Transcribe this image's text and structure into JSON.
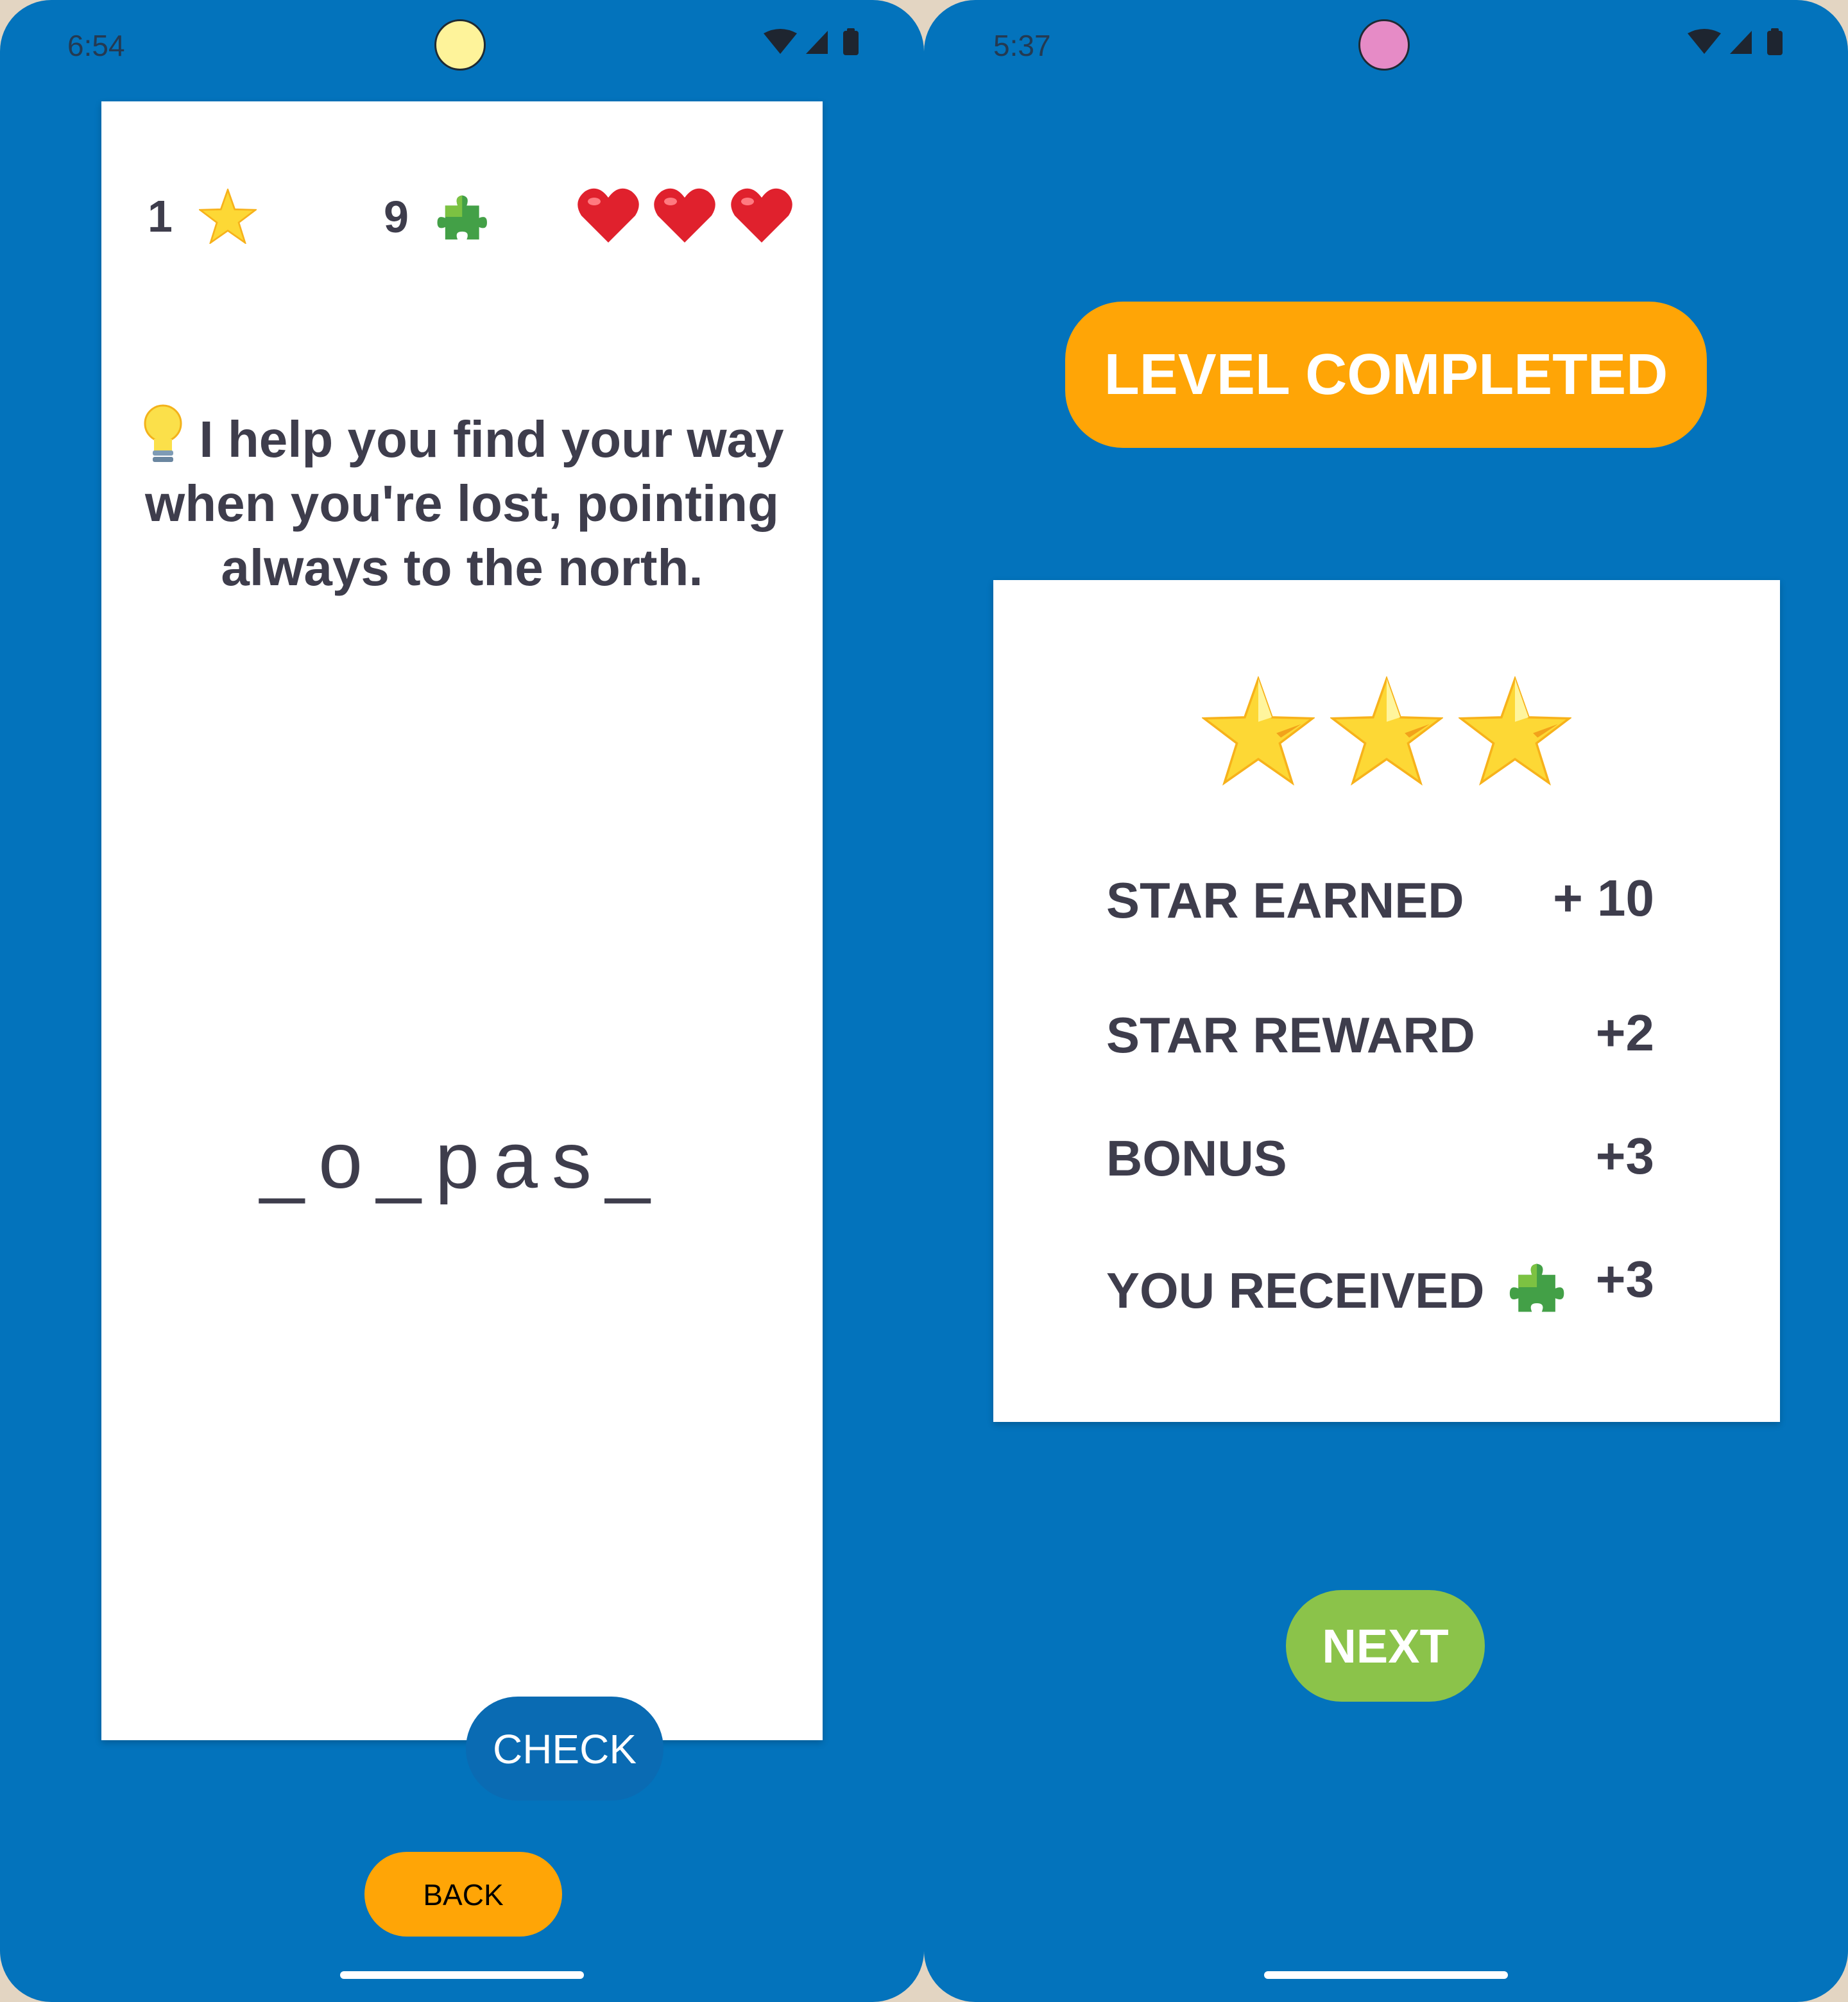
{
  "left_screen": {
    "status": {
      "time": "6:54",
      "camera_color": "#fef39a"
    },
    "stats": {
      "stars": "1",
      "stars_icon": "star-icon",
      "pieces": "9",
      "pieces_icon": "puzzle-piece-icon",
      "lives": 3,
      "lives_icon": "heart-icon"
    },
    "hint": {
      "icon": "light-bulb-icon",
      "text": "I help you find your way when you're lost, pointing always to the north."
    },
    "puzzle_word": "_o_pas_",
    "check_label": "CHECK",
    "back_label": "BACK"
  },
  "right_screen": {
    "status": {
      "time": "5:37",
      "camera_color": "#e68bc6"
    },
    "level_badge": "LEVEL COMPLETED",
    "stars_earned": 3,
    "rows": [
      {
        "label": "STAR EARNED",
        "value": "+ 10"
      },
      {
        "label": "STAR REWARD",
        "value": "+2"
      },
      {
        "label": "BONUS",
        "value": "+3"
      },
      {
        "label": "YOU RECEIVED",
        "value": "+3",
        "icon": "puzzle-piece-icon"
      }
    ],
    "next_label": "NEXT"
  },
  "colors": {
    "background": "#0373bc",
    "accent_orange": "#ffa506",
    "check_blue": "#0a6bb3",
    "next_green": "#8bc34a",
    "text_dark": "#3e3d4c"
  }
}
